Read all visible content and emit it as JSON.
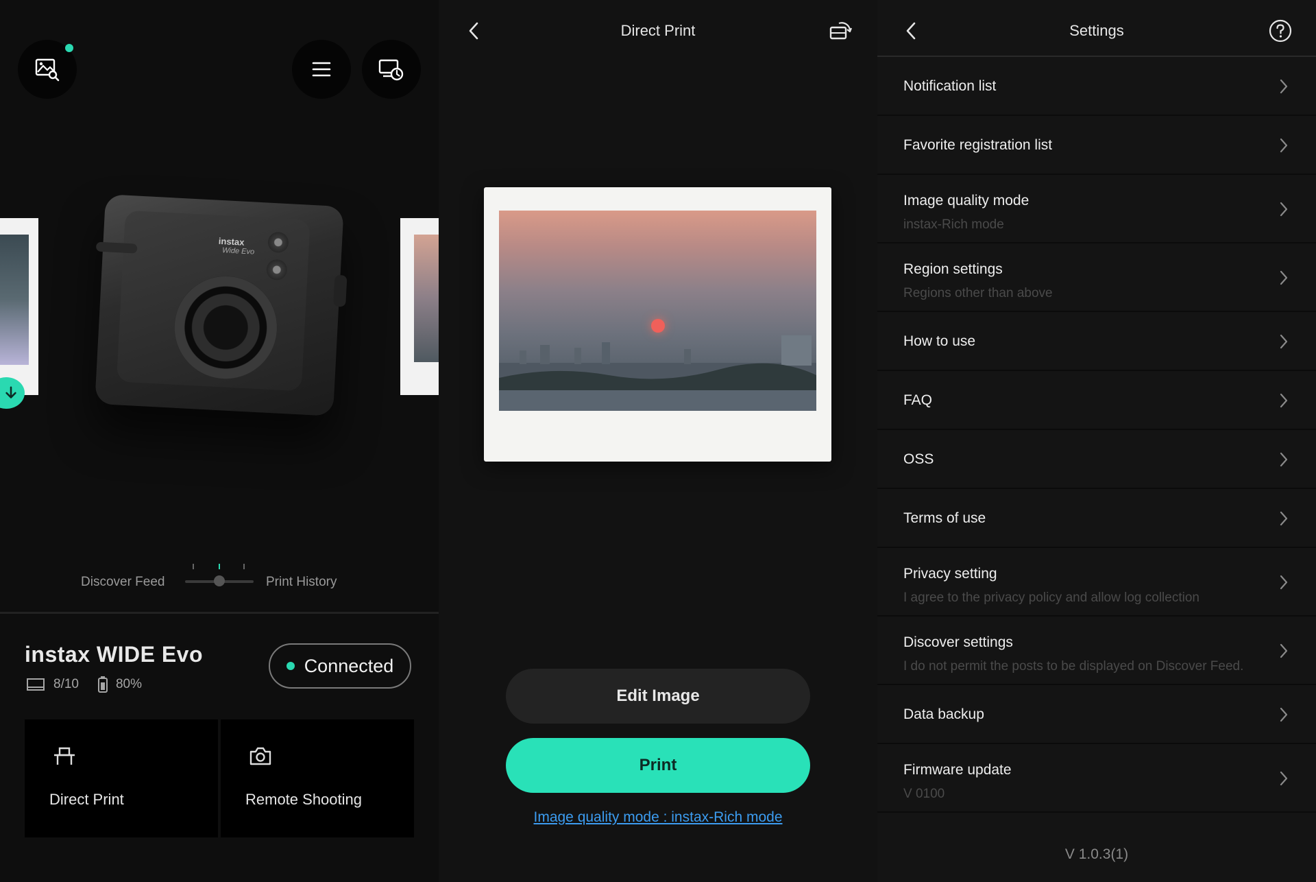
{
  "home": {
    "mode_left": "Discover Feed",
    "mode_right": "Print History",
    "camera_brand": "instax",
    "camera_model": "Wide Evo",
    "device_name": "instax WIDE Evo",
    "film_count": "8/10",
    "battery": "80%",
    "connection_status": "Connected",
    "tiles": [
      {
        "label": "Direct Print",
        "icon": "printer-icon"
      },
      {
        "label": "Remote Shooting",
        "icon": "camera-icon"
      }
    ],
    "icons": [
      "image-search-icon",
      "menu-icon",
      "print-history-icon",
      "download-icon"
    ]
  },
  "direct_print": {
    "title": "Direct Print",
    "edit_label": "Edit Image",
    "print_label": "Print",
    "quality_link": "Image quality mode : instax-Rich mode",
    "icons": [
      "back-icon",
      "rotate-icon"
    ]
  },
  "settings": {
    "title": "Settings",
    "items": [
      {
        "label": "Notification list",
        "sub": ""
      },
      {
        "label": "Favorite registration list",
        "sub": ""
      },
      {
        "label": "Image quality mode",
        "sub": "instax-Rich mode"
      },
      {
        "label": "Region settings",
        "sub": "Regions other than above"
      },
      {
        "label": "How to use",
        "sub": ""
      },
      {
        "label": "FAQ",
        "sub": ""
      },
      {
        "label": "OSS",
        "sub": ""
      },
      {
        "label": "Terms of use",
        "sub": ""
      },
      {
        "label": "Privacy setting",
        "sub": "I agree to the privacy policy and allow log collection"
      },
      {
        "label": "Discover settings",
        "sub": "I do not permit the posts to be displayed on Discover Feed."
      },
      {
        "label": "Data backup",
        "sub": ""
      },
      {
        "label": "Firmware update",
        "sub": "V 0100"
      }
    ],
    "version": "V  1.0.3(1)",
    "icons": [
      "back-icon",
      "help-icon",
      "chevron-right-icon"
    ]
  },
  "colors": {
    "accent": "#29e1b8",
    "link": "#3c9cf0",
    "background": "#121212"
  }
}
